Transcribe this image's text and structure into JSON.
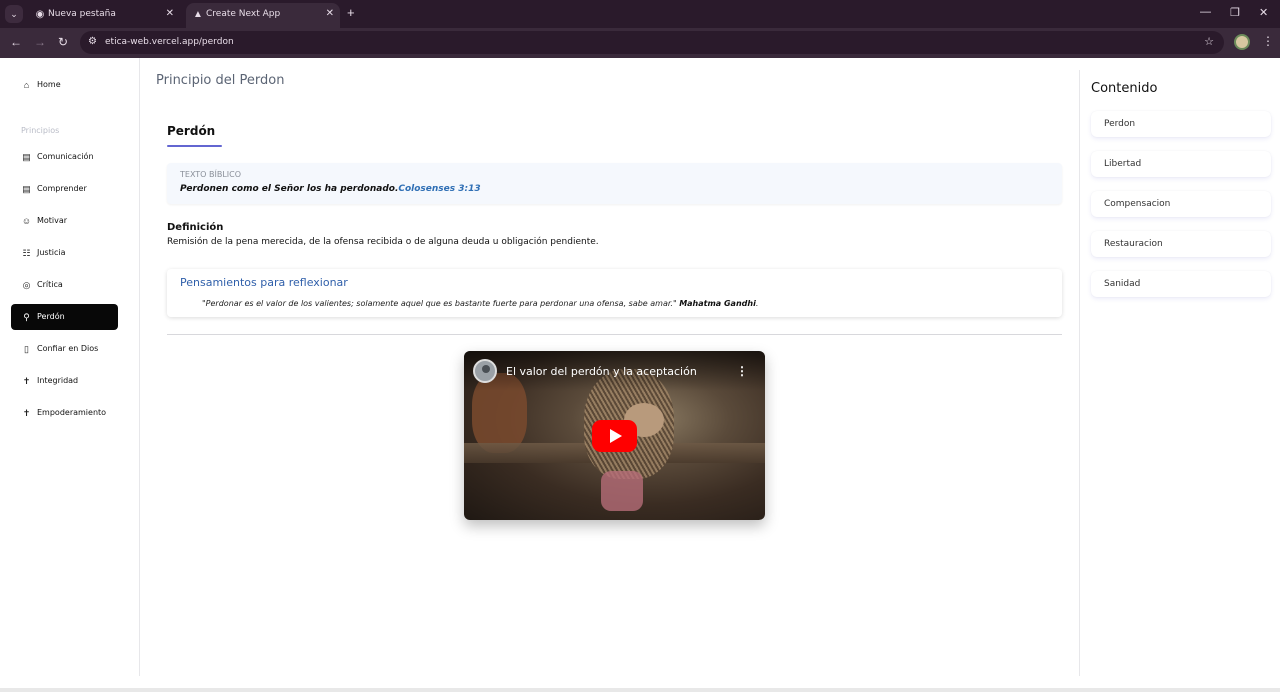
{
  "browser": {
    "tabs": [
      {
        "label": "Nueva pestaña",
        "icon": "globe-icon"
      },
      {
        "label": "Create Next App",
        "icon": "nextjs-icon"
      }
    ],
    "url": "etica-web.vercel.app/perdon"
  },
  "sidebar": {
    "home_label": "Home",
    "section_heading": "Principios",
    "items": [
      {
        "label": "Comunicación",
        "icon": "book-icon"
      },
      {
        "label": "Comprender",
        "icon": "document-icon"
      },
      {
        "label": "Motivar",
        "icon": "smile-icon"
      },
      {
        "label": "Justicia",
        "icon": "columns-icon"
      },
      {
        "label": "Crítica",
        "icon": "target-icon"
      },
      {
        "label": "Perdón",
        "icon": "person-icon"
      },
      {
        "label": "Confiar en Dios",
        "icon": "tablet-icon"
      },
      {
        "label": "Integridad",
        "icon": "figure-icon"
      },
      {
        "label": "Empoderamiento",
        "icon": "figure-icon"
      }
    ],
    "active_item": "Perdón"
  },
  "header": {
    "title": "Principio del Perdon"
  },
  "main": {
    "title": "Perdón",
    "bible": {
      "label": "TEXTO BÍBLICO",
      "text": "Perdonen como el Señor los ha perdonado.",
      "reference": "Colosenses 3:13"
    },
    "definition": {
      "title": "Definición",
      "text": "Remisión de la pena merecida, de la ofensa recibida o de alguna deuda u obligación pendiente."
    },
    "reflection": {
      "title": "Pensamientos para reflexionar",
      "quote": "\"Perdonar es el valor de los valientes; solamente aquel que es bastante fuerte para perdonar una ofensa, sabe amar.\"",
      "author": "Mahatma Gandhi",
      "end": "."
    },
    "video": {
      "title": "El valor del perdón y la aceptación"
    }
  },
  "toc": {
    "title": "Contenido",
    "items": [
      "Perdon",
      "Libertad",
      "Compensacion",
      "Restauracion",
      "Sanidad"
    ]
  }
}
